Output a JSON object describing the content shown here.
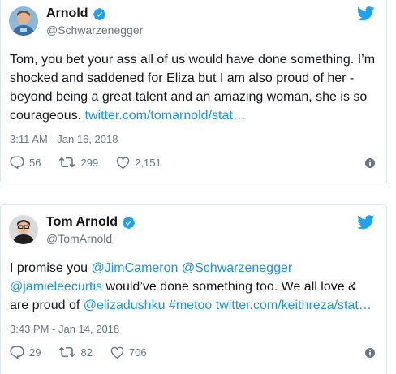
{
  "tweets": [
    {
      "name": "Arnold",
      "handle": "@Schwarzenegger",
      "text": "Tom, you bet your ass all of us would have done something. I’m shocked and saddened for Eliza but I am also proud of her - beyond being a great talent and an amazing woman, she is so courageous. ",
      "link": "twitter.com/tomarnold/stat…",
      "timestamp": "3:11 AM - Jan 16, 2018",
      "replies": "56",
      "retweets": "299",
      "likes": "2,151"
    },
    {
      "name": "Tom Arnold",
      "handle": "@TomArnold",
      "text_parts": {
        "p1": "I promise you ",
        "m1": "@JimCameron",
        "p2": " ",
        "m2": "@Schwarzenegger",
        "p3": " ",
        "m3": "@jamieleecurtis",
        "p4": " would’ve done something too. We all love & are proud of ",
        "m4": "@elizadushku",
        "p5": " ",
        "m5": "#metoo",
        "p6": " ",
        "m6": "twitter.com/keithreza/stat…"
      },
      "timestamp": "3:43 PM - Jan 14, 2018",
      "replies": "29",
      "retweets": "82",
      "likes": "706"
    }
  ],
  "colors": {
    "accent": "#1b95e0",
    "verified": "#1da1f2",
    "muted": "#657786",
    "retweet_icon": "#657786"
  },
  "icons": [
    "verified-badge-icon",
    "twitter-bird-icon",
    "reply-icon",
    "retweet-icon",
    "like-icon",
    "info-icon"
  ]
}
